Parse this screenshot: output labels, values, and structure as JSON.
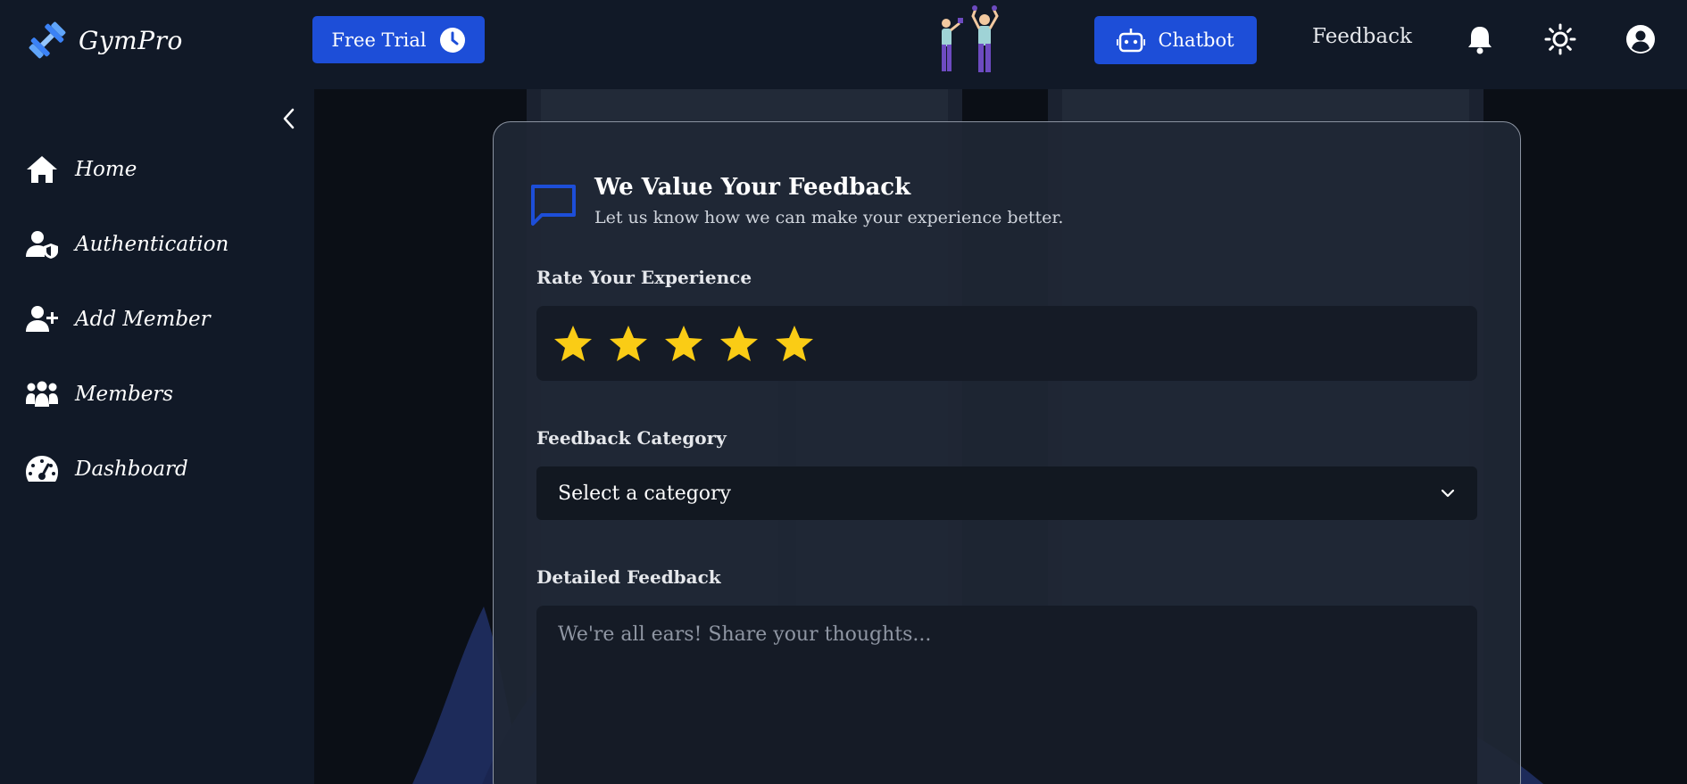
{
  "app": {
    "name": "GymPro"
  },
  "topbar": {
    "trial_label": "Free Trial",
    "chatbot_label": "Chatbot",
    "feedback_label": "Feedback"
  },
  "sidebar": {
    "items": [
      {
        "label": "Home",
        "icon": "home-icon"
      },
      {
        "label": "Authentication",
        "icon": "user-shield-icon"
      },
      {
        "label": "Add Member",
        "icon": "user-plus-icon"
      },
      {
        "label": "Members",
        "icon": "users-icon"
      },
      {
        "label": "Dashboard",
        "icon": "gauge-icon"
      }
    ]
  },
  "feedback_form": {
    "title": "We Value Your Feedback",
    "subtitle": "Let us know how we can make your experience better.",
    "rating_label": "Rate Your Experience",
    "rating": {
      "value": 5,
      "max": 5
    },
    "category_label": "Feedback Category",
    "category_selected": "Select a category",
    "details_label": "Detailed Feedback",
    "details_placeholder": "We're all ears! Share your thoughts..."
  },
  "colors": {
    "accent": "#1d4ed8",
    "star": "#facc15",
    "panel": "#111927"
  }
}
